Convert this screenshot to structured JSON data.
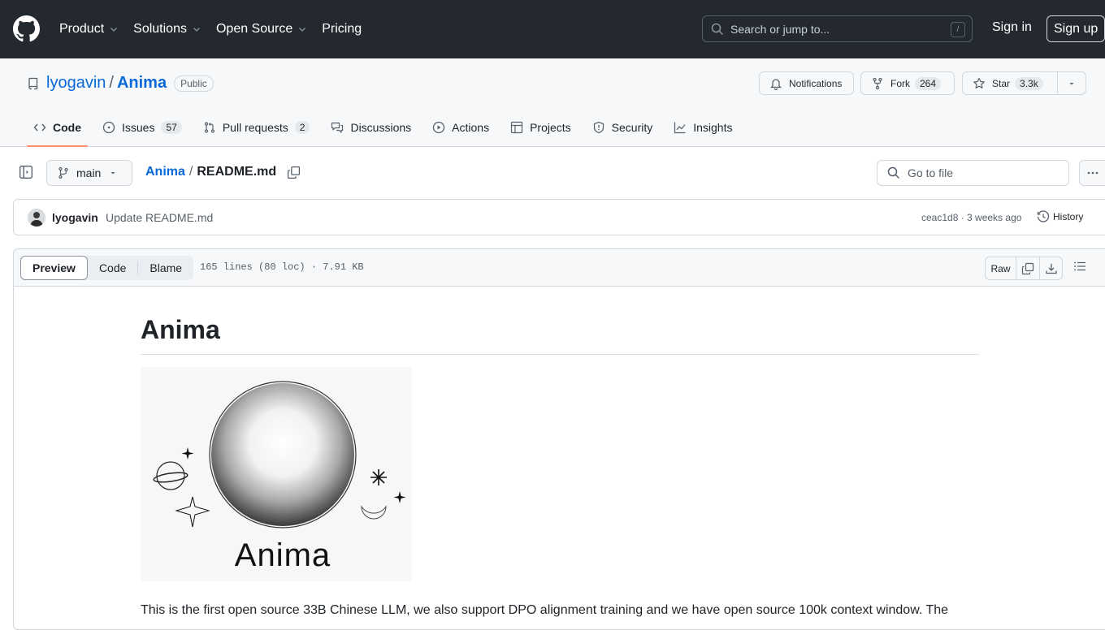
{
  "header": {
    "nav": [
      {
        "label": "Product",
        "dropdown": true
      },
      {
        "label": "Solutions",
        "dropdown": true
      },
      {
        "label": "Open Source",
        "dropdown": true
      },
      {
        "label": "Pricing",
        "dropdown": false
      }
    ],
    "search_placeholder": "Search or jump to...",
    "search_shortcut": "/",
    "sign_in": "Sign in",
    "sign_up": "Sign up"
  },
  "repo": {
    "owner": "lyogavin",
    "separator": "/",
    "name": "Anima",
    "visibility": "Public",
    "notifications_label": "Notifications",
    "fork_label": "Fork",
    "fork_count": "264",
    "star_label": "Star",
    "star_count": "3.3k",
    "tabs": [
      {
        "label": "Code",
        "icon": "code-icon",
        "active": true
      },
      {
        "label": "Issues",
        "icon": "issue-icon",
        "count": "57"
      },
      {
        "label": "Pull requests",
        "icon": "pull-request-icon",
        "count": "2"
      },
      {
        "label": "Discussions",
        "icon": "discussions-icon"
      },
      {
        "label": "Actions",
        "icon": "play-icon"
      },
      {
        "label": "Projects",
        "icon": "table-icon"
      },
      {
        "label": "Security",
        "icon": "shield-icon"
      },
      {
        "label": "Insights",
        "icon": "graph-icon"
      }
    ]
  },
  "file_nav": {
    "branch": "main",
    "breadcrumb_repo": "Anima",
    "breadcrumb_sep": "/",
    "file_name": "README.md",
    "goto_file_placeholder": "Go to file"
  },
  "commit": {
    "author": "lyogavin",
    "message": "Update README.md",
    "meta": "ceac1d8 · 3 weeks ago",
    "history_label": "History"
  },
  "file_view": {
    "tabs": [
      "Preview",
      "Code",
      "Blame"
    ],
    "active_tab": "Preview",
    "info": "165 lines (80 loc) · 7.91 KB",
    "raw_label": "Raw"
  },
  "readme": {
    "title": "Anima",
    "logo_text": "Anima",
    "paragraph": "This is the first open source 33B Chinese LLM, we also support DPO alignment training and we have open source 100k context window. The"
  }
}
